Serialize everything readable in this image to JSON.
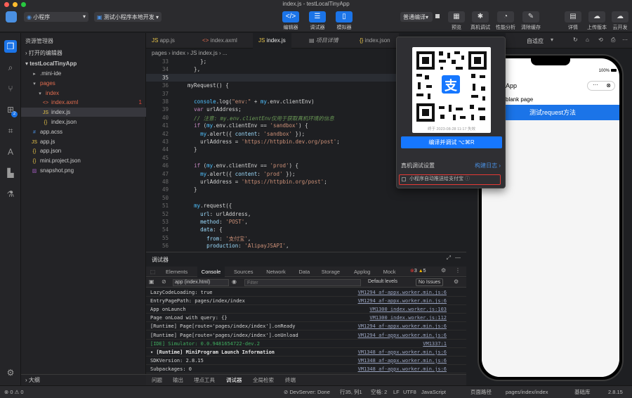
{
  "window": {
    "title": "index.js - testLocalTinyApp"
  },
  "toolbar": {
    "app_select": "小程序",
    "mode_select": "测试小程序本地开发",
    "editor": "编辑器",
    "debugger": "调试器",
    "simulator": "模拟器",
    "compile_mode": "普通编译",
    "preview": "预览",
    "real_debug": "真机调试",
    "perf": "性能分析",
    "clear_cache": "清除缓存",
    "details": "详情",
    "upload": "上传版本",
    "cloud": "云开发"
  },
  "explorer": {
    "header": "资源管理器",
    "open_editors": "打开的编辑器",
    "project": "testLocalTinyApp",
    "items": [
      {
        "name": ".mini-ide",
        "icon": "folder",
        "depth": 1,
        "badge": ""
      },
      {
        "name": "pages",
        "icon": "folder-open",
        "depth": 1,
        "badge": "",
        "color": "#e06c4f"
      },
      {
        "name": "index",
        "icon": "folder-open",
        "depth": 2,
        "badge": "",
        "color": "#e06c4f"
      },
      {
        "name": "index.axml",
        "icon": "axml",
        "depth": 3,
        "badge": "1",
        "color": "#e06c4f"
      },
      {
        "name": "index.js",
        "icon": "js",
        "depth": 3,
        "badge": "",
        "selected": true
      },
      {
        "name": "index.json",
        "icon": "json",
        "depth": 3,
        "badge": ""
      },
      {
        "name": "app.acss",
        "icon": "css",
        "depth": 1,
        "badge": ""
      },
      {
        "name": "app.js",
        "icon": "js",
        "depth": 1,
        "badge": ""
      },
      {
        "name": "app.json",
        "icon": "json",
        "depth": 1,
        "badge": ""
      },
      {
        "name": "mini.project.json",
        "icon": "json",
        "depth": 1,
        "badge": ""
      },
      {
        "name": "snapshot.png",
        "icon": "image",
        "depth": 1,
        "badge": ""
      }
    ],
    "outline": "大纲"
  },
  "tabs": [
    "app.js",
    "index.axml",
    "index.js",
    "项目详情",
    "index.json"
  ],
  "breadcrumb": "pages  ›  index  ›  JS index.js  ›  ...",
  "code": [
    {
      "n": "33",
      "t": "      };"
    },
    {
      "n": "34",
      "t": "    },"
    },
    {
      "n": "35",
      "t": ""
    },
    {
      "n": "36",
      "t": "  myRequest() {"
    },
    {
      "n": "37",
      "t": ""
    },
    {
      "n": "38",
      "t": "    console.log(\"env:\" + my.env.clientEnv)"
    },
    {
      "n": "39",
      "t": "    var urlAddress;"
    },
    {
      "n": "40",
      "t": "    // 注意: my.env.clientEnv仅用于获取真机环境的信息"
    },
    {
      "n": "41",
      "t": "    if (my.env.clientEnv == 'sandbox') {"
    },
    {
      "n": "42",
      "t": "      my.alert({ content: 'sandbox' });"
    },
    {
      "n": "43",
      "t": "      urlAddress = 'https://httpbin.dev.org/post';"
    },
    {
      "n": "44",
      "t": "    }"
    },
    {
      "n": "45",
      "t": ""
    },
    {
      "n": "46",
      "t": "    if (my.env.clientEnv == 'prod') {"
    },
    {
      "n": "47",
      "t": "      my.alert({ content: 'prod' });"
    },
    {
      "n": "48",
      "t": "      urlAddress = 'https://httpbin.org/post';"
    },
    {
      "n": "49",
      "t": "    }"
    },
    {
      "n": "50",
      "t": ""
    },
    {
      "n": "51",
      "t": "    my.request({"
    },
    {
      "n": "52",
      "t": "      url: urlAddress,"
    },
    {
      "n": "53",
      "t": "      method: 'POST',"
    },
    {
      "n": "54",
      "t": "      data: {"
    },
    {
      "n": "55",
      "t": "        from: '支付宝',"
    },
    {
      "n": "56",
      "t": "        production: 'AlipayJSAPI',"
    }
  ],
  "popup": {
    "qr_caption": "终于 2023-08-28 11:17 失效",
    "compile_button": "编译并调试 ⌥⌘R",
    "real_debug_settings": "真机调试设置",
    "build_log": "构建日志 ›",
    "auto_push": "小程序自动推送给支付宝"
  },
  "simulator": {
    "zoom": "自适应",
    "battery": "100%",
    "app_title": "App",
    "page_label": "blank page",
    "button_label": "测试request方法"
  },
  "debugger": {
    "title": "调试器",
    "tabs": [
      "Elements",
      "Console",
      "Sources",
      "Network",
      "Data",
      "Storage",
      "Applog",
      "Mock"
    ],
    "active_tab": "Console",
    "errors": "3",
    "warnings": "5",
    "context": "app (index.html)",
    "filter_placeholder": "Filter",
    "levels": "Default levels",
    "no_issues": "No Issues",
    "logs": [
      {
        "text": "      LazyCodeLoading: true",
        "src": "VM1294 af-appx.worker.min.js:6",
        "color": "#d4d4d4"
      },
      {
        "text": "      EntryPagePath: pages/index/index",
        "src": "VM1294 af-appx.worker.min.js:6",
        "color": "#d4d4d4"
      },
      {
        "text": "  App onLaunch",
        "src": "VM1300 index.worker.js:103",
        "color": "#d4d4d4"
      },
      {
        "text": "  Page onLoad with query: {}",
        "src": "VM1300 index.worker.js:112",
        "color": "#d4d4d4"
      },
      {
        "text": "  [Runtime] Page[route='pages/index/index'].onReady",
        "src": "VM1294 af-appx.worker.min.js:6",
        "color": "#d4d4d4"
      },
      {
        "text": "  [Runtime] Page[route='pages/index/index'].onUnload",
        "src": "VM1294 af-appx.worker.min.js:6",
        "color": "#d4d4d4"
      },
      {
        "text": "  [IDE] Simulator: 0.0.9481654722-dev.2",
        "src": "VM1337:1",
        "color": "#3fae5f"
      },
      {
        "text": "▾ [Runtime] MiniProgram Launch Information",
        "src": "VM1348 af-appx.worker.min.js:6",
        "color": "#e6e6e6"
      },
      {
        "text": "      SDKVersion: 2.8.15",
        "src": "VM1348 af-appx.worker.min.js:6",
        "color": "#d4d4d4"
      },
      {
        "text": "      Subpackages: 0",
        "src": "VM1348 af-appx.worker.min.js:6",
        "color": "#d4d4d4"
      }
    ]
  },
  "bottom_tabs": [
    "问题",
    "输出",
    "埋点工具",
    "调试器",
    "全局检索",
    "终端"
  ],
  "bottom_active": "调试器",
  "status": {
    "problems": "⊗ 0  ⚠ 0",
    "devserver": "⊘ DevServer: Done",
    "position": "行35, 列1",
    "spaces": "空格: 2",
    "eol": "LF",
    "encoding": "UTF8",
    "language": "JavaScript",
    "page_path_label": "页面路径",
    "page_path": "pages/index/index",
    "base_lib": "基础库",
    "version": "2.8.15"
  },
  "colors": {
    "accent": "#1b74e8",
    "alipay_blue": "#1677ff",
    "error_red": "#e53935"
  }
}
